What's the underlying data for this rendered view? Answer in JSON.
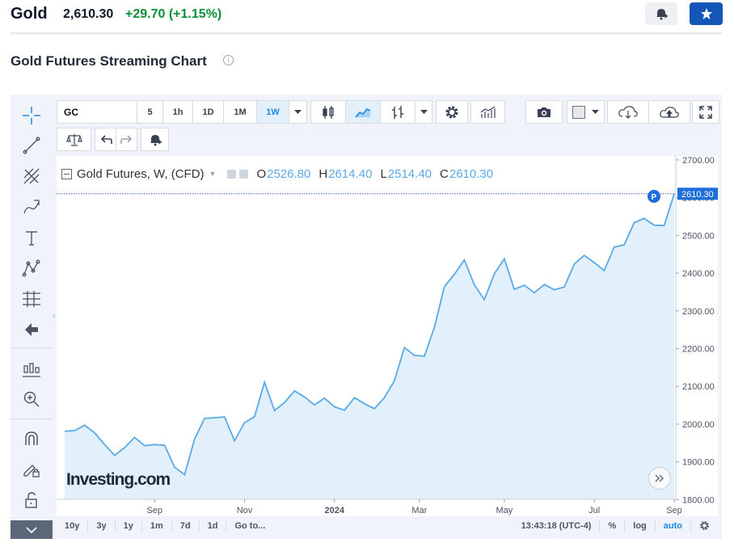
{
  "header": {
    "instrument": "Gold",
    "price": "2,610.30",
    "change": "+29.70",
    "change_pct": "(+1.15%)",
    "colors": {
      "up": "#0a8f36",
      "watch_button": "#1456b8"
    }
  },
  "section_title": "Gold Futures Streaming Chart",
  "toolbar": {
    "symbol": "GC",
    "intervals": [
      "5",
      "1h",
      "1D",
      "1M",
      "1W"
    ],
    "active_interval": "1W"
  },
  "legend": {
    "title": "Gold Futures, W, (CFD)",
    "open_label": "O",
    "open": "2526.80",
    "high_label": "H",
    "high": "2614.40",
    "low_label": "L",
    "low": "2514.40",
    "close_label": "C",
    "close": "2610.30"
  },
  "price_tag": "2610.30",
  "marker": "P",
  "watermark": "Investing.com",
  "bottom_bar": {
    "ranges": [
      "10y",
      "3y",
      "1y",
      "1m",
      "7d",
      "1d"
    ],
    "goto": "Go to...",
    "time": "13:43:18 (UTC-4)",
    "percent": "%",
    "log": "log",
    "auto": "auto"
  },
  "chart_data": {
    "type": "area",
    "x_ticks": [
      "Sep",
      "Nov",
      "2024",
      "Mar",
      "May",
      "Jul",
      "Sep"
    ],
    "y_ticks": [
      "2700.00",
      "2600.00",
      "2500.00",
      "2400.00",
      "2300.00",
      "2200.00",
      "2100.00",
      "2000.00",
      "1900.00",
      "1800.00"
    ],
    "ylim": [
      1800,
      2700
    ],
    "x_range": [
      0,
      56
    ],
    "values": [
      1981,
      1983,
      1997,
      1977,
      1946,
      1917,
      1938,
      1965,
      1943,
      1946,
      1944,
      1886,
      1866,
      1960,
      2015,
      2017,
      2019,
      1956,
      2004,
      2020,
      2111,
      2036,
      2057,
      2088,
      2072,
      2051,
      2069,
      2046,
      2037,
      2070,
      2054,
      2041,
      2070,
      2115,
      2203,
      2182,
      2180,
      2256,
      2364,
      2397,
      2435,
      2369,
      2330,
      2398,
      2438,
      2357,
      2368,
      2348,
      2370,
      2356,
      2363,
      2424,
      2447,
      2428,
      2407,
      2469,
      2475,
      2534,
      2545,
      2527,
      2526,
      2610
    ],
    "last_value": 2610.3,
    "colors": {
      "line": "#5aa9e6",
      "fill": "#e1f0fb",
      "price_tag": "#1e6fd9"
    }
  }
}
